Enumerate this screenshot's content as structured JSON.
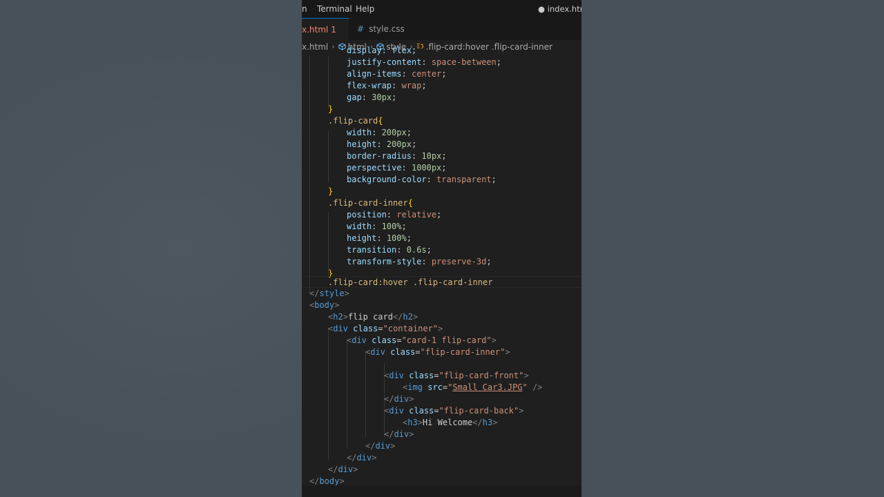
{
  "menu": {
    "item_partial": "n",
    "terminal": "Terminal",
    "help": "Help",
    "window_title": "● index.html -"
  },
  "tabs": [
    {
      "label": "x.html",
      "problems": "1",
      "dirty": true
    },
    {
      "label": "style.css"
    }
  ],
  "breadcrumb": {
    "file": "x.html",
    "html": "html",
    "style": "style",
    "selector": ".flip-card:hover .flip-card-inner"
  },
  "code": {
    "l0": "display: flex;",
    "l1_p": "justify-content",
    "l1_v": "space-between",
    "l2_p": "align-items",
    "l2_v": "center",
    "l3_p": "flex-wrap",
    "l3_v": "wrap",
    "l4_p": "gap",
    "l4_v": "30px",
    "sel_flip_card": ".flip-card",
    "fc_w_p": "width",
    "fc_w_v": "200px",
    "fc_h_p": "height",
    "fc_h_v": "200px",
    "fc_br_p": "border-radius",
    "fc_br_v": "10px",
    "fc_pe_p": "perspective",
    "fc_pe_v": "1000px",
    "fc_bg_p": "background-color",
    "fc_bg_v": "transparent",
    "sel_inner": ".flip-card-inner",
    "in_pos_p": "position",
    "in_pos_v": "relative",
    "in_w_p": "width",
    "in_w_v": "100%",
    "in_h_p": "height",
    "in_h_v": "100%",
    "in_tr_p": "transition",
    "in_tr_v": "0.6s",
    "in_ts_p": "transform-style",
    "in_ts_v": "preserve-3d",
    "sel_hover": ".flip-card:hover .flip-card-inner",
    "style_tag": "style",
    "body_tag": "body",
    "h2_tag": "h2",
    "h2_text": "flip card",
    "div_tag": "div",
    "class_attr": "class",
    "container": "container",
    "card_1": "card-1 flip-card",
    "inner": "flip-card-inner",
    "front": "flip-card-front",
    "img_tag": "img",
    "src_attr": "src",
    "img_src": "Small Car3.JPG",
    "back": "flip-card-back",
    "h3_tag": "h3",
    "h3_text": "Hi Welcome"
  }
}
